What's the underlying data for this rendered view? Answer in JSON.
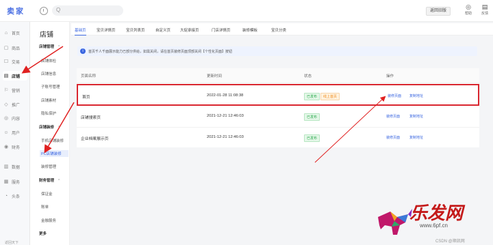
{
  "topbar": {
    "logo": "卖家",
    "search_placeholder": "Q",
    "old_version": "返回旧版",
    "help": "帮助",
    "feedback": "反馈"
  },
  "rail": {
    "items": [
      {
        "label": "首页",
        "icon": "home-icon",
        "glyph": "⌂"
      },
      {
        "label": "商品",
        "icon": "goods-icon",
        "glyph": "▢"
      },
      {
        "label": "交易",
        "icon": "trade-icon",
        "glyph": "☐"
      },
      {
        "label": "店铺",
        "icon": "shop-icon",
        "glyph": "▤"
      },
      {
        "label": "营销",
        "icon": "marketing-icon",
        "glyph": "⚐"
      },
      {
        "label": "推广",
        "icon": "promote-icon",
        "glyph": "◇"
      },
      {
        "label": "内容",
        "icon": "content-icon",
        "glyph": "◎"
      },
      {
        "label": "用户",
        "icon": "user-icon",
        "glyph": "☺"
      },
      {
        "label": "财务",
        "icon": "finance-icon",
        "glyph": "◉"
      },
      {
        "label": "数据",
        "icon": "data-icon",
        "glyph": "▥"
      },
      {
        "label": "服务",
        "icon": "service-icon",
        "glyph": "▦"
      },
      {
        "label": "头条",
        "icon": "headline-icon",
        "glyph": "◔"
      }
    ],
    "bottom": "返回天下"
  },
  "submenu": {
    "title": "店铺",
    "items": [
      {
        "label": "店铺管理",
        "group": true
      },
      {
        "label": "店铺体检"
      },
      {
        "label": "店铺信息"
      },
      {
        "label": "子账号管理"
      },
      {
        "label": "店铺素材"
      },
      {
        "label": "隐私保护"
      },
      {
        "label": "店铺装修",
        "group": true
      },
      {
        "label": "手机店铺装修"
      },
      {
        "label": "PC店铺装修",
        "active": true
      },
      {
        "label": "装修管理"
      },
      {
        "label": "财务管理",
        "group": true
      },
      {
        "label": "保证金"
      },
      {
        "label": "账单"
      },
      {
        "label": "金融服务"
      },
      {
        "label": "更多",
        "group": true
      }
    ]
  },
  "tabs": [
    "基础页",
    "宝贝详情页",
    "宝贝列表页",
    "自定义页",
    "大促承接页",
    "门店详情页",
    "装修模板",
    "宝贝分类"
  ],
  "notice": "首页千人千面展示能力已部分供给，如需关闭，请在首页装修页面顶部关闭【个性化页面】按钮",
  "table": {
    "headers": [
      "页面名称",
      "更新时间",
      "状态",
      "操作"
    ],
    "rows": [
      {
        "name": "首页",
        "time": "2022-01-28 11:08:38",
        "status": [
          "已发布",
          "线上首页"
        ],
        "actions": [
          "装修页面",
          "复制地址"
        ]
      },
      {
        "name": "店铺搜索页",
        "time": "2021-12-21 12:46:03",
        "status": [
          "已发布"
        ],
        "actions": [
          "装修页面",
          "复制地址"
        ]
      },
      {
        "name": "企业档案展示页",
        "time": "2021-12-21 12:46:03",
        "status": [
          "已发布"
        ],
        "actions": [
          "装修页面",
          "复制地址"
        ]
      }
    ]
  },
  "watermark": {
    "brand": "乐发网",
    "url": "www.6pf.cn",
    "csdn": "CSDN @顺凯网"
  },
  "colors": {
    "accent": "#3a66e0",
    "highlight": "#d9252e",
    "published": "#27a84a",
    "online": "#f08a1c"
  }
}
